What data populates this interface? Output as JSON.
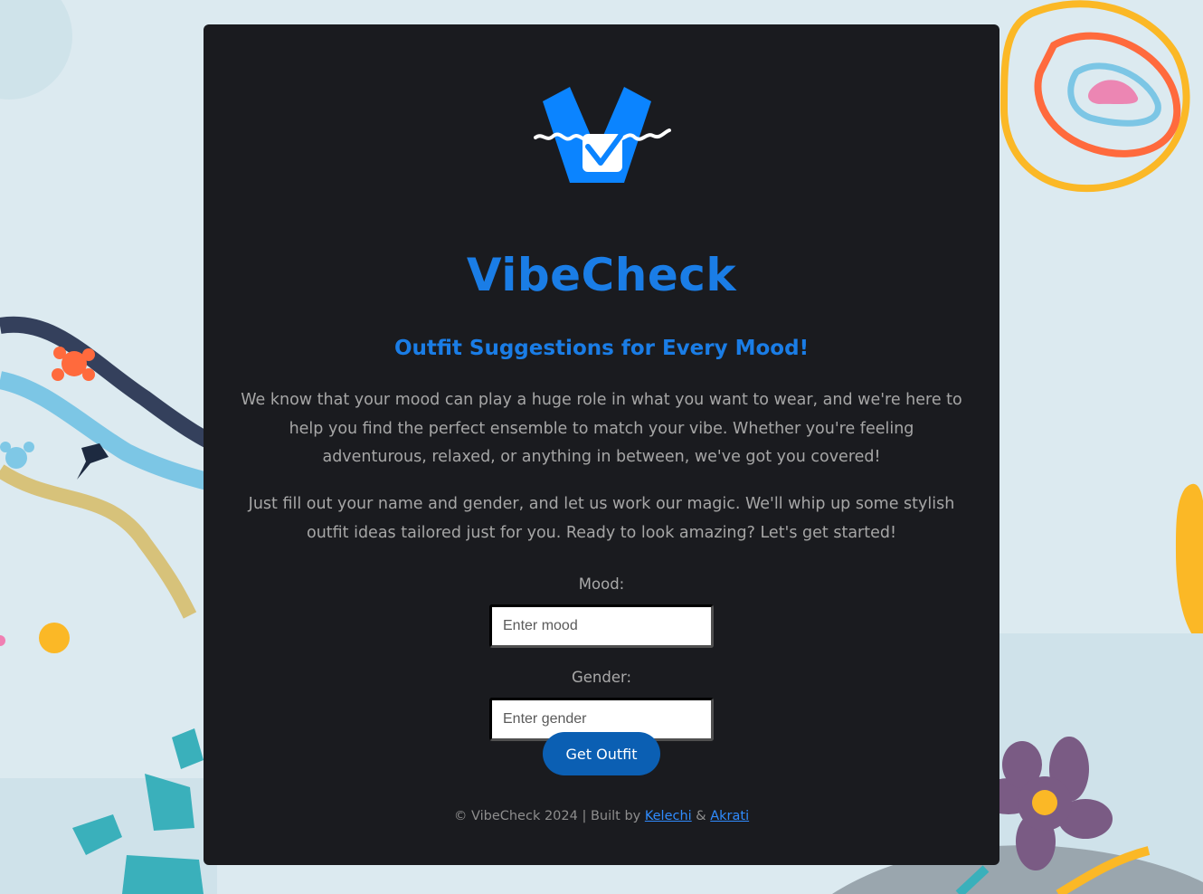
{
  "app": {
    "title": "VibeCheck",
    "subtitle": "Outfit Suggestions for Every Mood!",
    "intro_paragraph": "We know that your mood can play a huge role in what you want to wear, and we're here to help you find the perfect ensemble to match your vibe. Whether you're feeling adventurous, relaxed, or anything in between, we've got you covered!",
    "instructions_paragraph": "Just fill out your name and gender, and let us work our magic. We'll whip up some stylish outfit ideas tailored just for you. Ready to look amazing? Let's get started!"
  },
  "form": {
    "mood_label": "Mood:",
    "mood_placeholder": "Enter mood",
    "mood_value": "",
    "gender_label": "Gender:",
    "gender_placeholder": "Enter gender",
    "gender_value": "",
    "submit_label": "Get Outfit"
  },
  "footer": {
    "prefix": "© VibeCheck 2024 | Built by ",
    "author1": "Kelechi",
    "separator": " & ",
    "author2": "Akrati"
  },
  "icons": {
    "logo": "vibecheck-logo-icon"
  },
  "colors": {
    "accent": "#1a7de6",
    "button": "#0b5fb3",
    "card": "#1a1b1f",
    "link": "#2f8cff",
    "background": "#dbeaf0"
  }
}
